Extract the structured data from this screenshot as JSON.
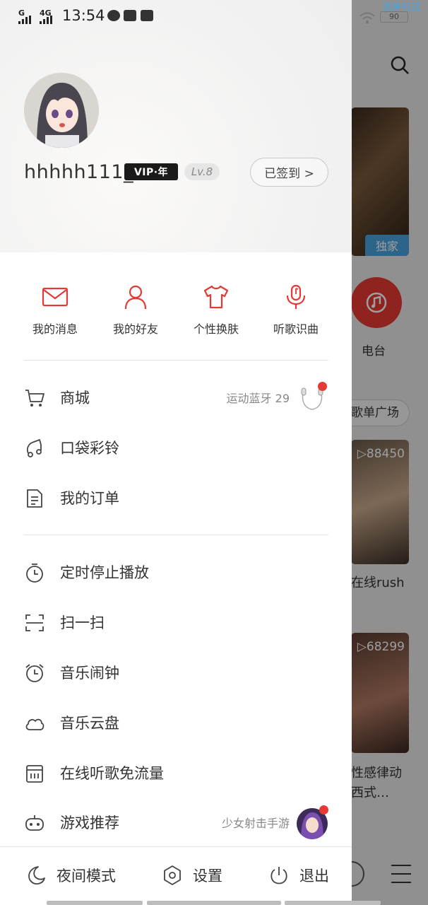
{
  "status_bar": {
    "signal1": "G",
    "signal2": "4G",
    "time": "13:54",
    "battery": "90",
    "corner_text": "流星社区"
  },
  "background": {
    "exclusive_tag": "独家",
    "radio_label": "电台",
    "playlist_pill": "歌单广场",
    "play_count_1": "▷88450",
    "item_title_1": "在线rush",
    "play_count_2": "▷68299",
    "item_title_2": "性感律动",
    "item_title_2b": "西式…"
  },
  "profile": {
    "username": "hhhhh111_",
    "vip_badge": "VIP·年",
    "level": "Lv.8",
    "checkin_label": "已签到 >"
  },
  "quick_actions": [
    {
      "label": "我的消息",
      "icon": "mail-icon"
    },
    {
      "label": "我的好友",
      "icon": "person-icon"
    },
    {
      "label": "个性换肤",
      "icon": "tshirt-icon"
    },
    {
      "label": "听歌识曲",
      "icon": "mic-icon"
    }
  ],
  "menu_group1": [
    {
      "label": "商城",
      "right_text": "运动蓝牙 29",
      "icon": "cart-icon"
    },
    {
      "label": "口袋彩铃",
      "icon": "ringtone-icon"
    },
    {
      "label": "我的订单",
      "icon": "document-icon"
    }
  ],
  "menu_group2": [
    {
      "label": "定时停止播放",
      "icon": "timer-icon"
    },
    {
      "label": "扫一扫",
      "icon": "scan-icon"
    },
    {
      "label": "音乐闹钟",
      "icon": "alarm-icon"
    },
    {
      "label": "音乐云盘",
      "icon": "cloud-icon"
    },
    {
      "label": "在线听歌免流量",
      "icon": "sim-card-icon"
    },
    {
      "label": "游戏推荐",
      "right_text": "少女射击手游",
      "icon": "gamepad-icon"
    }
  ],
  "footer": {
    "night_mode": "夜间模式",
    "settings": "设置",
    "logout": "退出"
  },
  "colors": {
    "accent_red": "#e53935",
    "text": "#333333",
    "muted": "#888888"
  }
}
